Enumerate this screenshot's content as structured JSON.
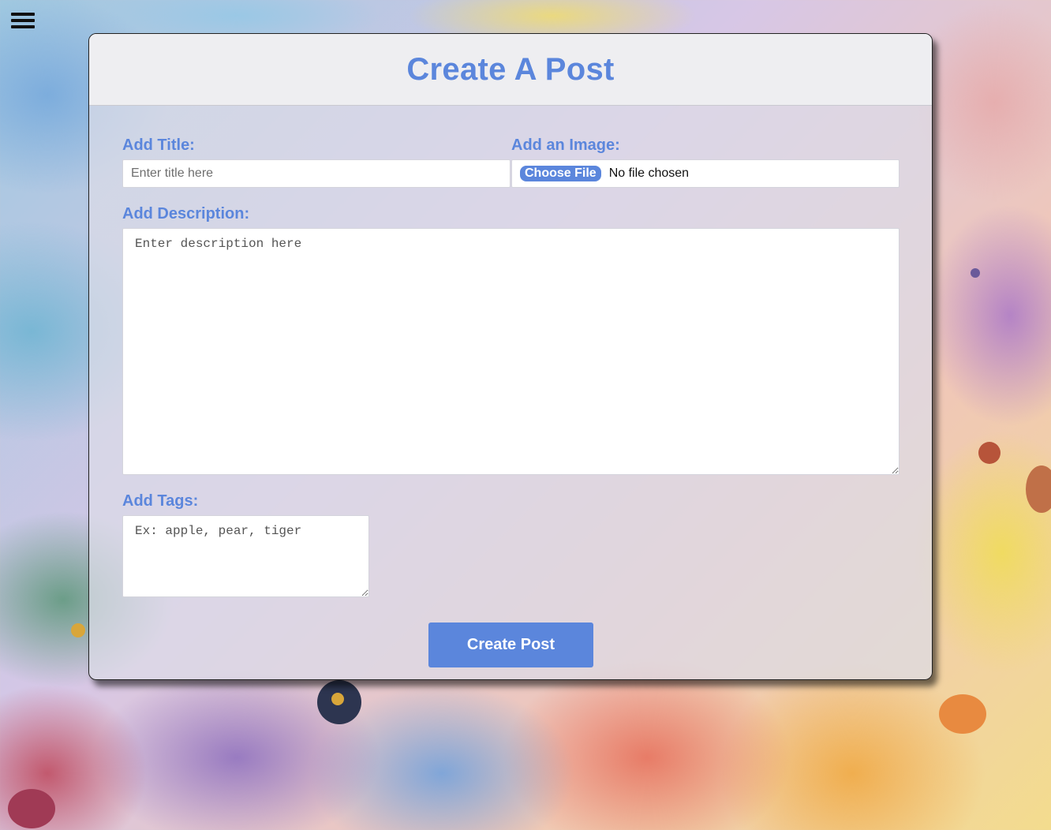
{
  "nav": {
    "menu_icon": "hamburger-menu-icon"
  },
  "form": {
    "title": "Create A Post",
    "title_field": {
      "label": "Add Title:",
      "placeholder": "Enter title here",
      "value": ""
    },
    "image_field": {
      "label": "Add an Image:",
      "button_label": "Choose File",
      "status": "No file chosen"
    },
    "description_field": {
      "label": "Add Description:",
      "placeholder": "Enter description here",
      "value": ""
    },
    "tags_field": {
      "label": "Add Tags:",
      "placeholder": "Ex: apple, pear, tiger",
      "value": ""
    },
    "submit_label": "Create Post"
  },
  "colors": {
    "accent": "#5b86dc",
    "header_bg": "#eeeef1"
  }
}
